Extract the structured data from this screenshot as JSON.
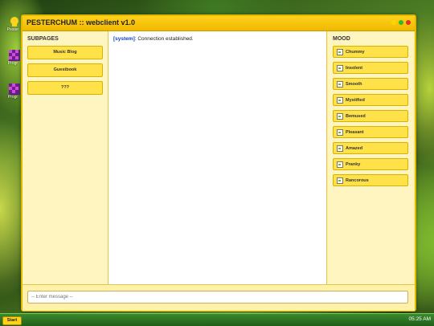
{
  "window": {
    "title": "PESTERCHUM :: webclient v1.0",
    "dot_colors": [
      "#f5d800",
      "#2dbb2d",
      "#e03030"
    ]
  },
  "desktop": {
    "icons": [
      {
        "label": "Pester",
        "icon": "pesterchum-icon"
      },
      {
        "label": "Progr",
        "icon": "program-icon"
      },
      {
        "label": "Progr",
        "icon": "program-icon"
      }
    ]
  },
  "subpages": {
    "heading": "SUBPAGES",
    "items": [
      "Music Blog",
      "Guestbook",
      "???"
    ]
  },
  "chat": {
    "system_tag": "[system]",
    "system_text": ": Connection established."
  },
  "mood": {
    "heading": "MOOD",
    "items": [
      "Chummy",
      "Insolent",
      "Smooth",
      "Mystified",
      "Bemused",
      "Pleasant",
      "Amazed",
      "Pranky",
      "Rancorous"
    ]
  },
  "input": {
    "placeholder": "-- Enter message --"
  },
  "taskbar": {
    "start_label": "Start",
    "clock": "05:25 AM"
  },
  "colors": {
    "accent": "#ffd21c",
    "button": "#ffe24a",
    "panel": "#fff5c0",
    "taskbar": "#2f7a24"
  }
}
